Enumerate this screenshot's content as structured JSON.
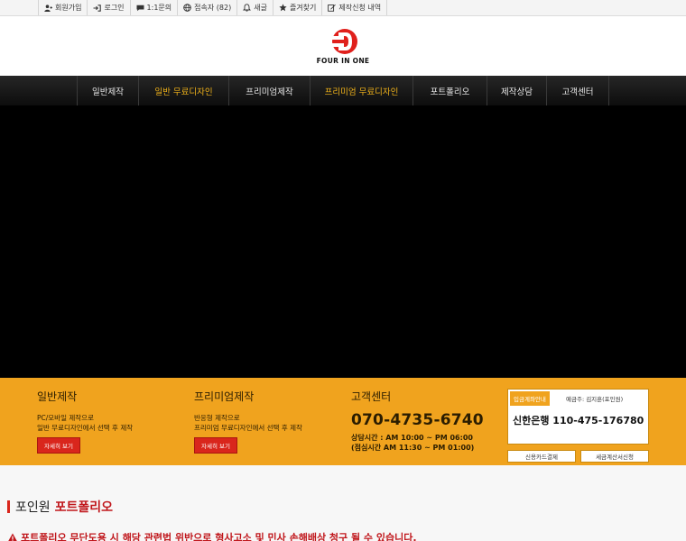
{
  "topbar": {
    "items": [
      {
        "label": "회원가입",
        "icon": "user-plus-icon"
      },
      {
        "label": "로그인",
        "icon": "login-icon"
      },
      {
        "label": "1:1문의",
        "icon": "chat-icon"
      },
      {
        "label": "접속자 (82)",
        "icon": "globe-icon"
      },
      {
        "label": "새글",
        "icon": "bell-icon"
      },
      {
        "label": "즐겨찾기",
        "icon": "star-icon"
      },
      {
        "label": "제작신청 내역",
        "icon": "edit-icon"
      }
    ]
  },
  "header": {
    "logo_text": "FOUR IN ONE"
  },
  "nav": {
    "items": [
      {
        "label": "일반제작"
      },
      {
        "label": "일반 무료디자인"
      },
      {
        "label": "프리미엄제작"
      },
      {
        "label": "프리미엄 무료디자인"
      },
      {
        "label": "포트폴리오"
      },
      {
        "label": "제작상담"
      },
      {
        "label": "고객센터"
      }
    ]
  },
  "strip": {
    "general": {
      "title": "일반제작",
      "line1": "PC/모바일 제작으로",
      "line2": "일반 무료디자인에서 선택 후 제작",
      "button": "자세히 보기"
    },
    "premium": {
      "title": "프리미엄제작",
      "line1": "반응형 제작으로",
      "line2": "프리미엄 무료디자인에서 선택 후 제작",
      "button": "자세히 보기"
    },
    "support": {
      "title": "고객센터",
      "phone": "070-4735-6740",
      "hours1": "상담시간 : AM 10:00 ~ PM 06:00",
      "hours2": "(점심시간 AM 11:30 ~ PM 01:00)"
    },
    "bank": {
      "label": "입금계좌안내",
      "holder": "예금주: 김지훈(포인원)",
      "account": "신한은행 110-475-176780"
    },
    "pay_card": "신용카드결제",
    "tax_invoice": "세금계산서신청"
  },
  "portfolio": {
    "title_prefix": "포인원",
    "title_highlight": "포트폴리오",
    "warning": "포트폴리오 무단도용 시 해당 관련법 위반으로 형사고소 및 민사 손해배상 청구 될 수 있습니다."
  },
  "colors": {
    "accent_orange": "#f0a31e",
    "accent_red": "#d9261c",
    "nav_active": "#f0b21a"
  }
}
